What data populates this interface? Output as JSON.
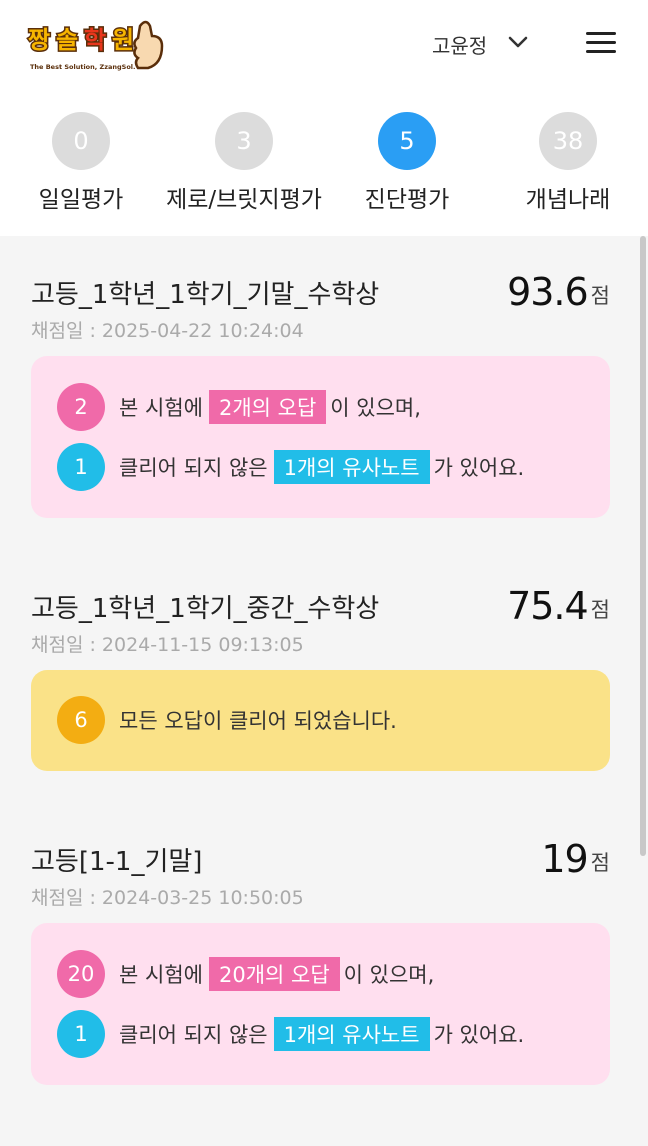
{
  "header": {
    "logo_alt": "짱솔학원 The Best Solution, Zzang Sol.",
    "user_name": "고윤정"
  },
  "tabs": [
    {
      "count": "0",
      "label": "일일평가",
      "active": false
    },
    {
      "count": "3",
      "label": "제로/브릿지평가",
      "active": false
    },
    {
      "count": "5",
      "label": "진단평가",
      "active": true
    },
    {
      "count": "38",
      "label": "개념나래",
      "active": false
    }
  ],
  "exams": [
    {
      "title": "고등_1학년_1학기_기말_수학상",
      "date": "채점일 : 2025-04-22 10:24:04",
      "score": "93.6",
      "score_unit": "점",
      "wrong_count": "2",
      "line1_prefix": "본 시험에",
      "line1_highlight": "2개의 오답",
      "line1_suffix": "이 있으며,",
      "note_count": "1",
      "line2_prefix": "클리어 되지 않은",
      "line2_highlight": "1개의 유사노트",
      "line2_suffix": "가 있어요."
    },
    {
      "title": "고등_1학년_1학기_중간_수학상",
      "date": "채점일 : 2024-11-15 09:13:05",
      "score": "75.4",
      "score_unit": "점",
      "cleared_count": "6",
      "cleared_text": "모든 오답이 클리어 되었습니다."
    },
    {
      "title": "고등[1-1_기말]",
      "date": "채점일 : 2024-03-25 10:50:05",
      "score": "19",
      "score_unit": "점",
      "wrong_count": "20",
      "line1_prefix": "본 시험에",
      "line1_highlight": "20개의 오답",
      "line1_suffix": "이 있으며,",
      "note_count": "1",
      "line2_prefix": "클리어 되지 않은",
      "line2_highlight": "1개의 유사노트",
      "line2_suffix": "가 있어요."
    }
  ],
  "colors": {
    "active_tab": "#2a9ef4",
    "pink": "#f06aa9",
    "blue": "#21bde8",
    "orange": "#f3ad12",
    "card_pink": "#ffdfef",
    "card_yellow": "#fae288"
  }
}
